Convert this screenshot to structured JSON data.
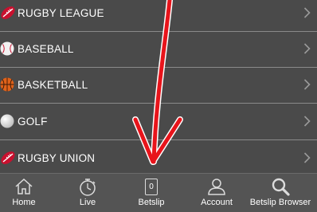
{
  "sports": [
    {
      "label": "RUGBY LEAGUE",
      "icon": "rugby-ball-icon"
    },
    {
      "label": "BASEBALL",
      "icon": "baseball-icon"
    },
    {
      "label": "BASKETBALL",
      "icon": "basketball-icon"
    },
    {
      "label": "GOLF",
      "icon": "golf-ball-icon"
    },
    {
      "label": "RUGBY UNION",
      "icon": "rugby-ball-icon"
    }
  ],
  "tabs": [
    {
      "label": "Home",
      "icon": "home-icon"
    },
    {
      "label": "Live",
      "icon": "stopwatch-icon"
    },
    {
      "label": "Betslip",
      "icon": "betslip-icon",
      "count": "0"
    },
    {
      "label": "Account",
      "icon": "user-icon"
    },
    {
      "label": "Betslip Browser",
      "icon": "search-icon"
    }
  ],
  "colors": {
    "background": "#4a4a4a",
    "tabbar": "#545454",
    "annotation_arrow": "#e8141b",
    "rugby_ball": "#c8102e",
    "basketball": "#e0621a"
  }
}
